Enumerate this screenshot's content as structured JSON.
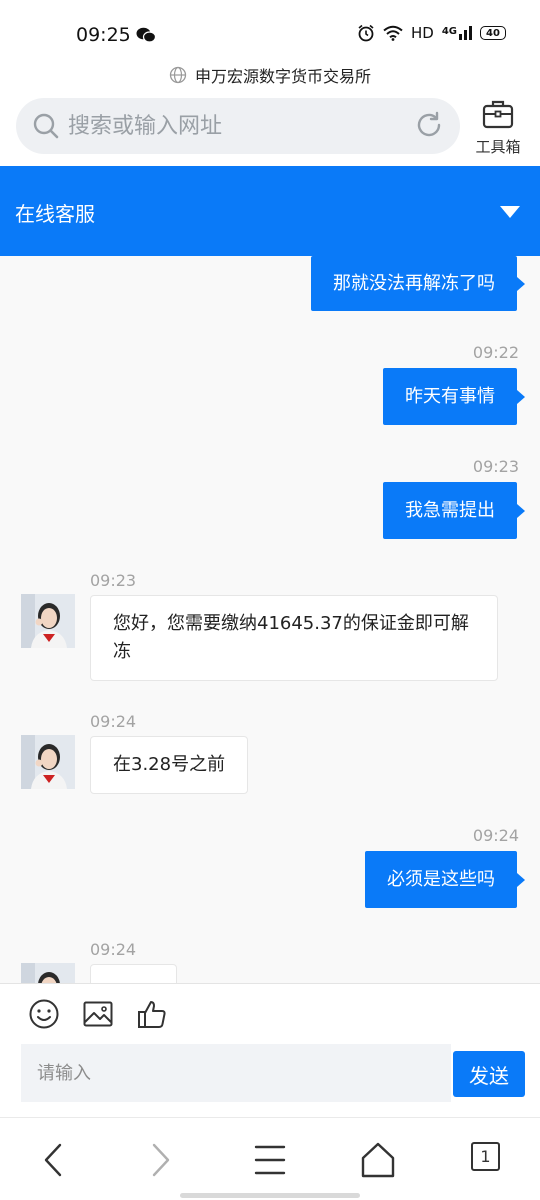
{
  "status_bar": {
    "time": "09:25",
    "network": "HD",
    "signal": "4G",
    "battery": "40"
  },
  "browser": {
    "site_title": "申万宏源数字货币交易所",
    "search_placeholder": "搜索或输入网址",
    "toolbox_label": "工具箱"
  },
  "chat": {
    "header_title": "在线客服",
    "messages": [
      {
        "from": "user",
        "text": "那就没法再解冻了吗"
      },
      {
        "from": "user",
        "time": "09:22",
        "text": "昨天有事情"
      },
      {
        "from": "user",
        "time": "09:23",
        "text": "我急需提出"
      },
      {
        "from": "agent",
        "time": "09:23",
        "text": "您好，您需要缴纳41645.37的保证金即可解冻"
      },
      {
        "from": "agent",
        "time": "09:24",
        "text": "在3.28号之前"
      },
      {
        "from": "user",
        "time": "09:24",
        "text": "必须是这些吗"
      },
      {
        "from": "agent",
        "time": "09:24",
        "text": ""
      }
    ]
  },
  "composer": {
    "input_placeholder": "请输入",
    "send_label": "发送",
    "tools": [
      "emoji-icon",
      "image-icon",
      "thumbs-up-icon"
    ]
  },
  "bottom_nav": {
    "tab_count": "1"
  },
  "colors": {
    "accent": "#0a7af8",
    "chat_bg": "#f9f9f9",
    "timestamp": "#a3a3a3"
  }
}
